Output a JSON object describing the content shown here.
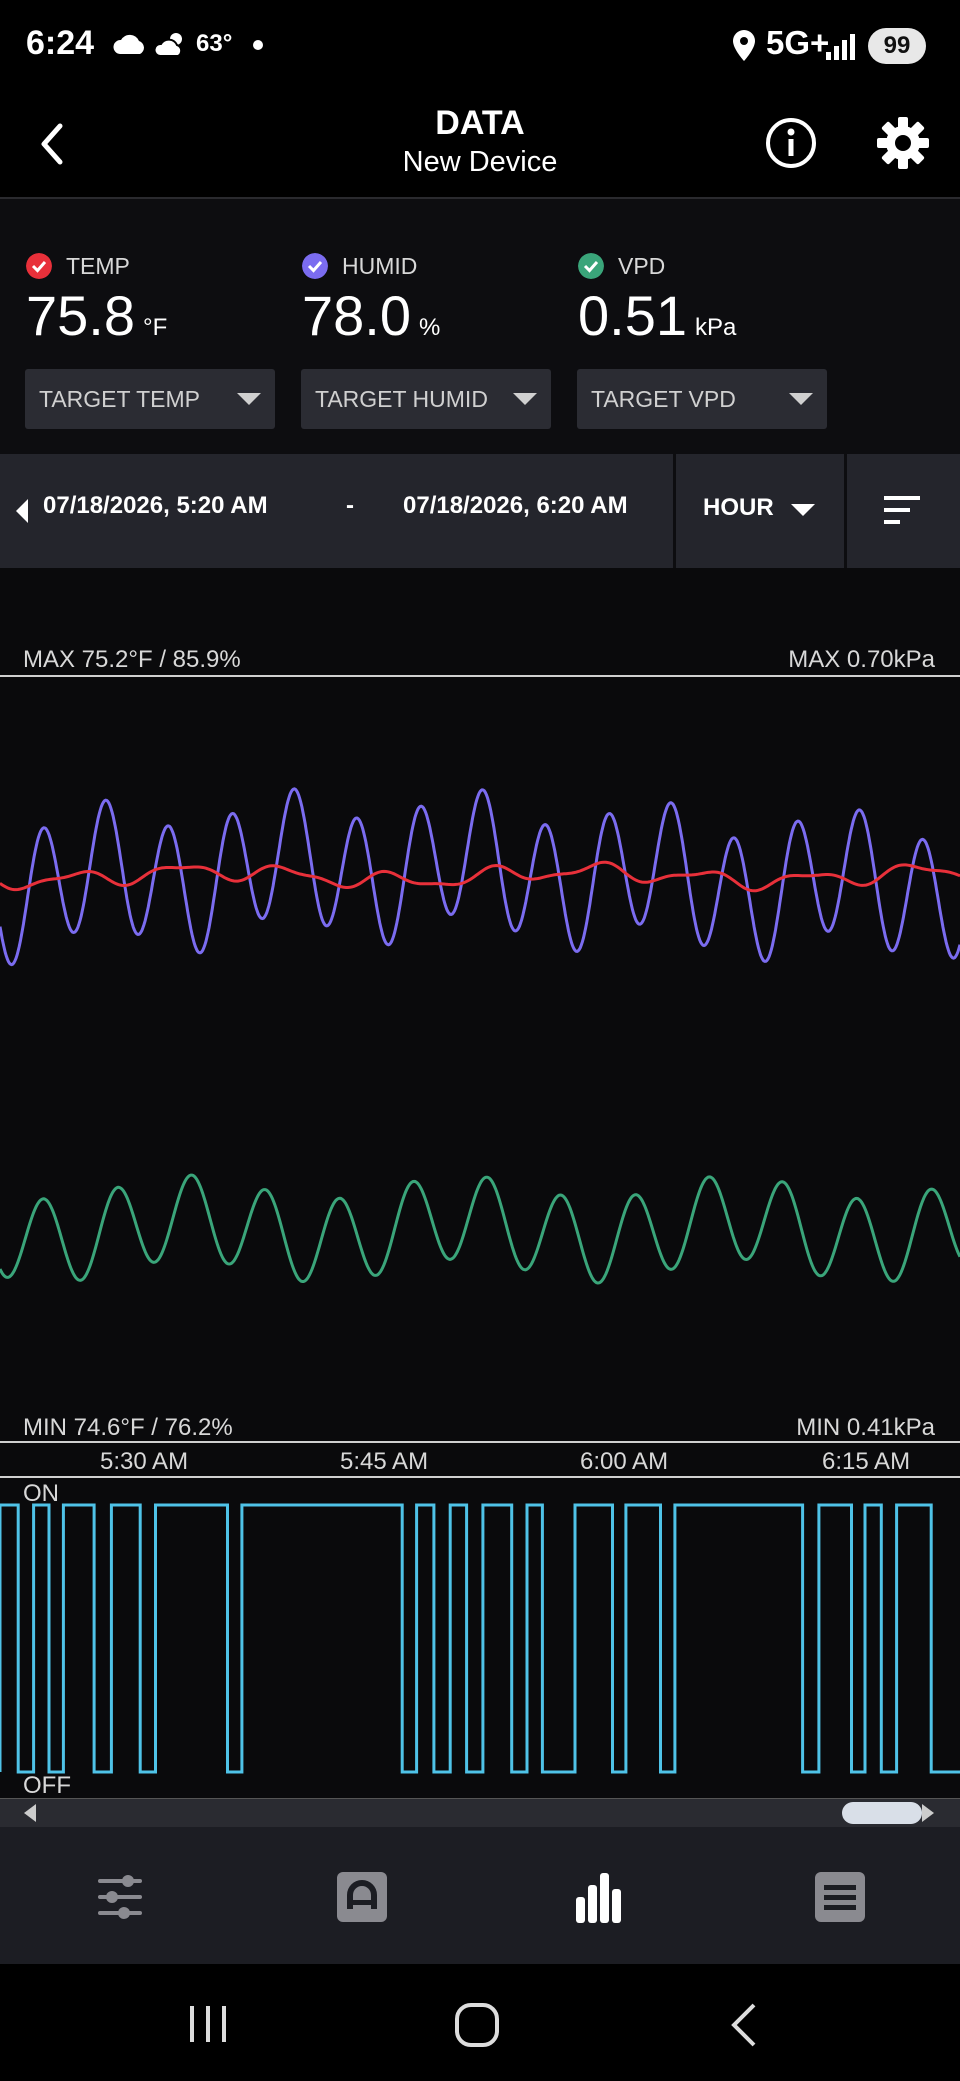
{
  "status_bar": {
    "time": "6:24",
    "weather_temp": "63°",
    "network": "5G+",
    "battery": "99"
  },
  "header": {
    "title": "DATA",
    "subtitle": "New Device"
  },
  "readings": [
    {
      "label": "TEMP",
      "value": "75.8",
      "unit": "°F",
      "color": "#e8303a",
      "target_label": "TARGET TEMP"
    },
    {
      "label": "HUMID",
      "value": "78.0",
      "unit": "%",
      "color": "#7b6cf0",
      "target_label": "TARGET HUMID"
    },
    {
      "label": "VPD",
      "value": "0.51",
      "unit": "kPa",
      "color": "#3aa57a",
      "target_label": "TARGET VPD"
    }
  ],
  "range": {
    "start": "07/18/2026, 5:20 AM",
    "separator": "-",
    "end": "07/18/2026, 6:20 AM",
    "interval": "HOUR"
  },
  "chart": {
    "max_left": "MAX 75.2°F / 85.9%",
    "max_right": "MAX 0.70kPa",
    "min_left": "MIN 74.6°F / 76.2%",
    "min_right": "MIN 0.41kPa",
    "time_ticks": [
      "5:30 AM",
      "5:45 AM",
      "6:00 AM",
      "6:15 AM"
    ],
    "on_label": "ON",
    "off_label": "OFF"
  },
  "chart_data": {
    "type": "line",
    "x_ticks": [
      "5:30 AM",
      "5:45 AM",
      "6:00 AM",
      "6:15 AM"
    ],
    "series": [
      {
        "color": "#e8303a",
        "range": [
          74.6,
          75.2
        ],
        "unit": "°F"
      },
      {
        "color": "#7b6cf0",
        "range": [
          76.2,
          85.9
        ],
        "unit": "%"
      },
      {
        "color": "#3aa57a",
        "range": [
          0.41,
          0.7
        ],
        "unit": "kPa"
      }
    ],
    "device_state": {
      "levels": [
        "OFF",
        "ON"
      ],
      "on_intervals": [
        [
          0.0,
          0.019
        ],
        [
          0.035,
          0.051
        ],
        [
          0.066,
          0.098
        ],
        [
          0.116,
          0.146
        ],
        [
          0.162,
          0.237
        ],
        [
          0.252,
          0.419
        ],
        [
          0.434,
          0.452
        ],
        [
          0.469,
          0.486
        ],
        [
          0.503,
          0.533
        ],
        [
          0.549,
          0.565
        ],
        [
          0.599,
          0.638
        ],
        [
          0.652,
          0.688
        ],
        [
          0.703,
          0.836
        ],
        [
          0.853,
          0.887
        ],
        [
          0.901,
          0.918
        ],
        [
          0.934,
          0.97
        ]
      ],
      "color": "#4fc3e8"
    }
  },
  "nav": {
    "items": [
      "controls",
      "automation",
      "data",
      "logs"
    ],
    "active": "data"
  },
  "colors": {
    "background": "#0a0a0c",
    "panel": "#2b2c33",
    "switch_line": "#4fc3e8"
  }
}
